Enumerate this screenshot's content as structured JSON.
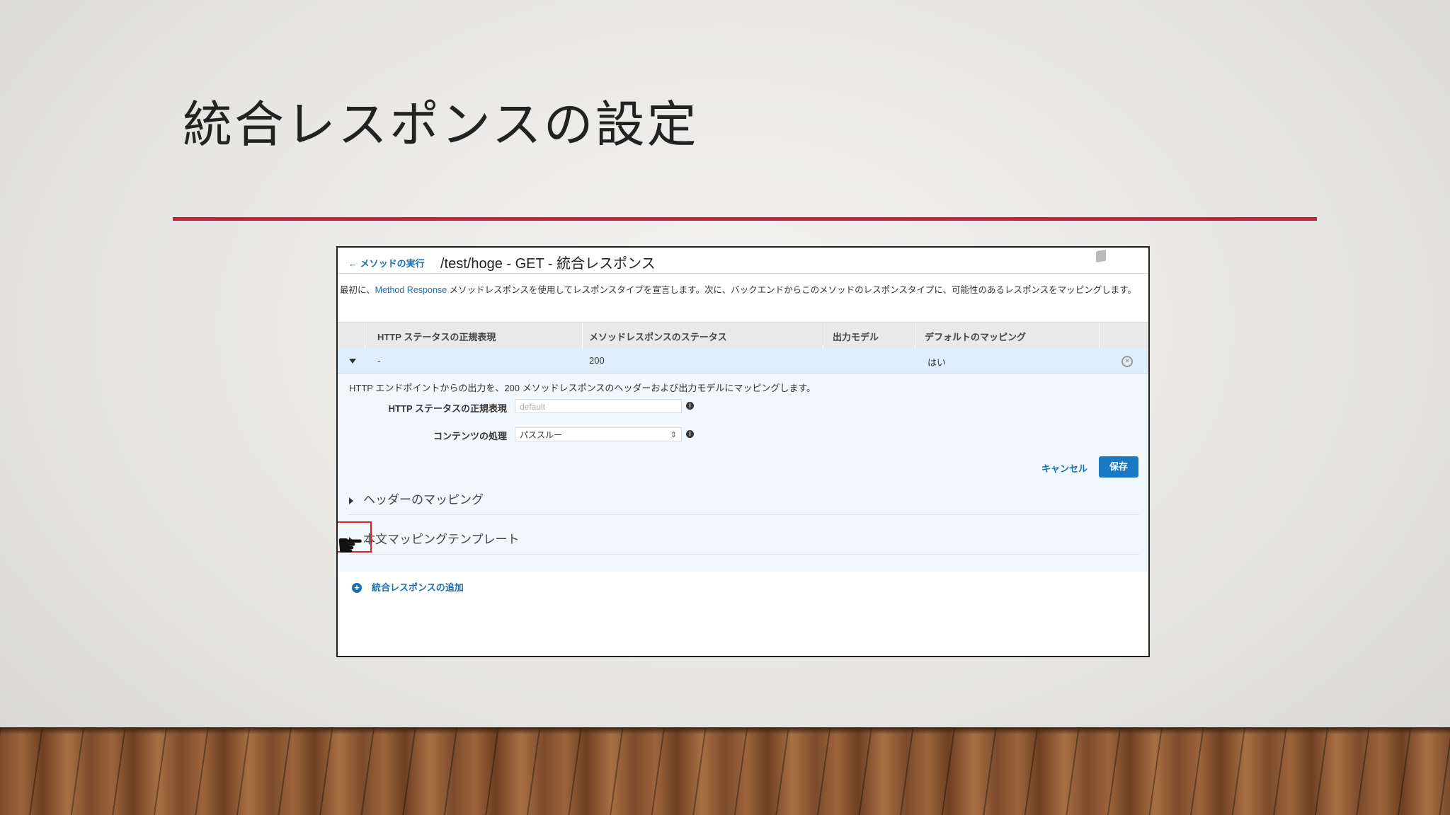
{
  "slide": {
    "title": "統合レスポンスの設定"
  },
  "screenshot": {
    "back_link": "← メソッドの実行",
    "heading": "/test/hoge - GET - 統合レスポンス",
    "intro_prefix": "最初に、",
    "intro_link": "Method Response",
    "intro_suffix": " メソッドレスポンスを使用してレスポンスタイプを宣言します。次に、バックエンドからこのメソッドのレスポンスタイプに、可能性のあるレスポンスをマッピングします。",
    "table": {
      "headers": [
        "HTTP ステータスの正規表現",
        "メソッドレスポンスのステータス",
        "出力モデル",
        "デフォルトのマッピング"
      ],
      "row": {
        "regex": "-",
        "status": "200",
        "model": "",
        "default_mapping": "はい"
      }
    },
    "detail": {
      "description": "HTTP エンドポイントからの出力を、200 メソッドレスポンスのヘッダーおよび出力モデルにマッピングします。",
      "regex_label": "HTTP ステータスの正規表現",
      "regex_placeholder": "default",
      "content_label": "コンテンツの処理",
      "content_value": "パススルー",
      "cancel_label": "キャンセル",
      "save_label": "保存",
      "header_mapping_label": "ヘッダーのマッピング",
      "body_template_label": "本文マッピングテンプレート"
    },
    "add_response_label": "統合レスポンスの追加"
  },
  "colors": {
    "accent_rule": "#c41e3a",
    "link": "#1a6fb3",
    "save_button": "#1a79c4",
    "highlight": "#e02020"
  }
}
